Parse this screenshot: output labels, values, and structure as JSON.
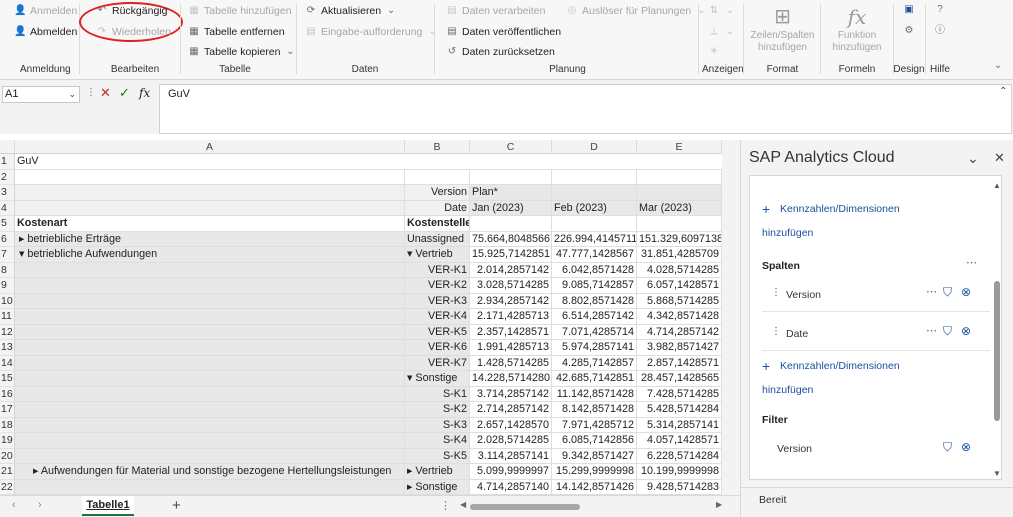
{
  "ribbon": {
    "anmelden_group": {
      "abmelden_top": "Anmelden",
      "abmelden": "Abmelden",
      "label": "Anmeldung"
    },
    "bearbeiten_group": {
      "undo": "Rückgängig",
      "redo": "Wiederholen",
      "label": "Bearbeiten"
    },
    "tabelle_group": {
      "add": "Tabelle hinzufügen",
      "remove": "Tabelle entfernen",
      "copy": "Tabelle kopieren",
      "label": "Tabelle"
    },
    "daten_group": {
      "refresh": "Aktualisieren",
      "prompt": "Eingabe-aufforderung",
      "label": "Daten"
    },
    "planung_group": {
      "process": "Daten verarbeiten",
      "trigger": "Auslöser für Planungen",
      "publish": "Daten veröffentlichen",
      "reset": "Daten zurücksetzen",
      "label": "Planung"
    },
    "anzeigen_group": {
      "label": "Anzeigen"
    },
    "format_group": {
      "rows_cols": "Zeilen/Spalten hinzufügen",
      "label": "Format"
    },
    "formeln_group": {
      "function": "Funktion hinzufügen",
      "label": "Formeln"
    },
    "design_group": {
      "label": "Design"
    },
    "hilfe_group": {
      "label": "Hilfe"
    }
  },
  "formula_bar": {
    "name_box": "A1",
    "fx": "fx",
    "content": "GuV"
  },
  "sheet": {
    "columns": [
      "A",
      "B",
      "C",
      "D",
      "E"
    ],
    "rows": [
      {
        "n": "1",
        "a": "GuV",
        "b": "",
        "c": "",
        "d": "",
        "e": ""
      },
      {
        "n": "2",
        "a": "",
        "b": "",
        "c": "",
        "d": "",
        "e": ""
      },
      {
        "n": "3",
        "a": "",
        "b": "Version",
        "c": "Plan*",
        "d": "",
        "e": ""
      },
      {
        "n": "4",
        "a": "",
        "b": "Date",
        "c": "Jan (2023)",
        "d": "Feb (2023)",
        "e": "Mar (2023)"
      },
      {
        "n": "5",
        "a": "Kostenart",
        "b": "Kostenstelle",
        "c": "",
        "d": "",
        "e": ""
      },
      {
        "n": "6",
        "a": "▸ betriebliche Erträge",
        "b": "Unassigned",
        "c": "75.664,8048566",
        "d": "226.994,4145711",
        "e": "151.329,6097138"
      },
      {
        "n": "7",
        "a": "▾ betriebliche Aufwendungen",
        "b": "▾ Vertrieb",
        "c": "15.925,7142851",
        "d": "47.777,1428567",
        "e": "31.851,4285709"
      },
      {
        "n": "8",
        "a": "",
        "b": "VER-K1",
        "c": "2.014,2857142",
        "d": "6.042,8571428",
        "e": "4.028,5714285"
      },
      {
        "n": "9",
        "a": "",
        "b": "VER-K2",
        "c": "3.028,5714285",
        "d": "9.085,7142857",
        "e": "6.057,1428571"
      },
      {
        "n": "10",
        "a": "",
        "b": "VER-K3",
        "c": "2.934,2857142",
        "d": "8.802,8571428",
        "e": "5.868,5714285"
      },
      {
        "n": "11",
        "a": "",
        "b": "VER-K4",
        "c": "2.171,4285713",
        "d": "6.514,2857142",
        "e": "4.342,8571428"
      },
      {
        "n": "12",
        "a": "",
        "b": "VER-K5",
        "c": "2.357,1428571",
        "d": "7.071,4285714",
        "e": "4.714,2857142"
      },
      {
        "n": "13",
        "a": "",
        "b": "VER-K6",
        "c": "1.991,4285713",
        "d": "5.974,2857141",
        "e": "3.982,8571427"
      },
      {
        "n": "14",
        "a": "",
        "b": "VER-K7",
        "c": "1.428,5714285",
        "d": "4.285,7142857",
        "e": "2.857,1428571"
      },
      {
        "n": "15",
        "a": "",
        "b": "▾ Sonstige",
        "c": "14.228,5714280",
        "d": "42.685,7142851",
        "e": "28.457,1428565"
      },
      {
        "n": "16",
        "a": "",
        "b": "S-K1",
        "c": "3.714,2857142",
        "d": "11.142,8571428",
        "e": "7.428,5714285"
      },
      {
        "n": "17",
        "a": "",
        "b": "S-K2",
        "c": "2.714,2857142",
        "d": "8.142,8571428",
        "e": "5.428,5714284"
      },
      {
        "n": "18",
        "a": "",
        "b": "S-K3",
        "c": "2.657,1428570",
        "d": "7.971,4285712",
        "e": "5.314,2857141"
      },
      {
        "n": "19",
        "a": "",
        "b": "S-K4",
        "c": "2.028,5714285",
        "d": "6.085,7142856",
        "e": "4.057,1428571"
      },
      {
        "n": "20",
        "a": "",
        "b": "S-K5",
        "c": "3.114,2857141",
        "d": "9.342,8571427",
        "e": "6.228,5714284"
      },
      {
        "n": "21",
        "a": "▸ Aufwendungen für Material und sonstige bezogene Hertellungsleistungen",
        "b": "▸ Vertrieb",
        "c": "5.099,9999997",
        "d": "15.299,9999998",
        "e": "10.199,9999998"
      },
      {
        "n": "22",
        "a": "",
        "b": "▸ Sonstige",
        "c": "4.714,2857140",
        "d": "14.142,8571426",
        "e": "9.428,5714283"
      }
    ],
    "tab_name": "Tabelle1"
  },
  "panel": {
    "title": "SAP Analytics Cloud",
    "add_measures_1": "Kennzahlen/Dimensionen",
    "add_1": "hinzufügen",
    "columns_label": "Spalten",
    "col_item_1": "Version",
    "col_item_2": "Date",
    "add_measures_2": "Kennzahlen/Dimensionen",
    "add_2": "hinzufügen",
    "filter_label": "Filter",
    "filter_item_1": "Version",
    "status": "Bereit"
  }
}
